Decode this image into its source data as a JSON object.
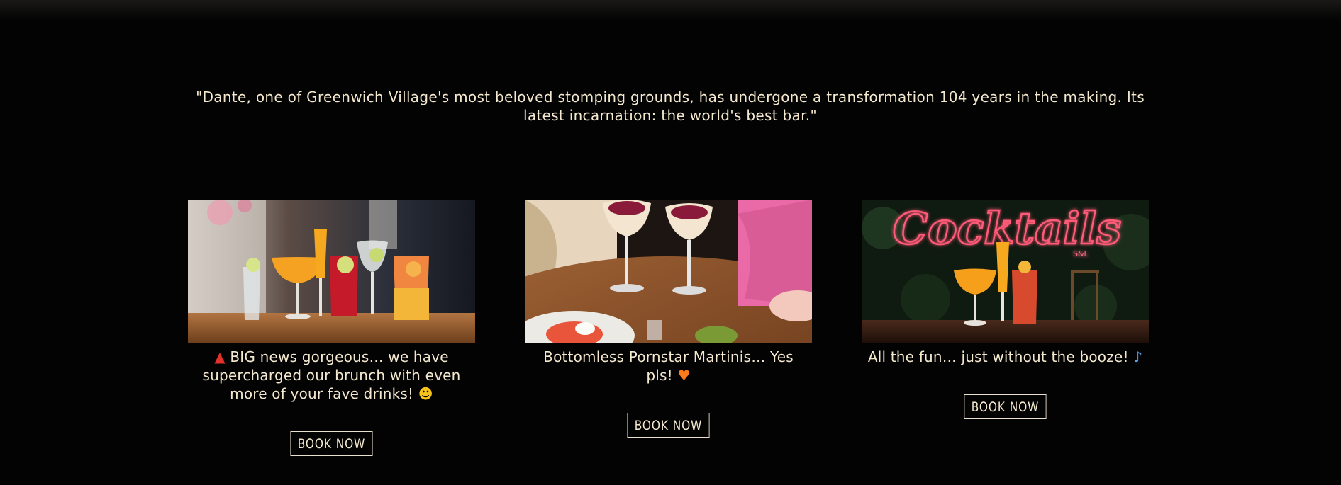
{
  "quote": {
    "text": "\"Dante, one of Greenwich Village's most beloved stomping grounds, has undergone a transformation 104 years in the making. Its latest incarnation: the world's best bar.\""
  },
  "cards": [
    {
      "caption_pre_icon": "siren-emoji",
      "caption": " BIG news gorgeous… we have supercharged our brunch with even more of your fave drinks! ",
      "caption_post_icon": "star-struck-emoji",
      "image_alt": "cocktails-on-table",
      "button_label": "BOOK NOW"
    },
    {
      "caption": "Bottomless Pornstar Martinis… Yes pls! ",
      "caption_post_icon": "orange-heart-emoji",
      "image_alt": "toasting-pornstar-martinis",
      "button_label": "BOOK NOW"
    },
    {
      "caption": "All the fun… just without the booze! ",
      "caption_post_icon": "dancing-person-emoji",
      "image_alt": "cocktails-neon-sign",
      "neon_text": "Cocktails",
      "button_label": "BOOK NOW"
    }
  ],
  "colors": {
    "background": "#030303",
    "text": "#f4e8cf",
    "button_border": "#e9e0cf"
  }
}
